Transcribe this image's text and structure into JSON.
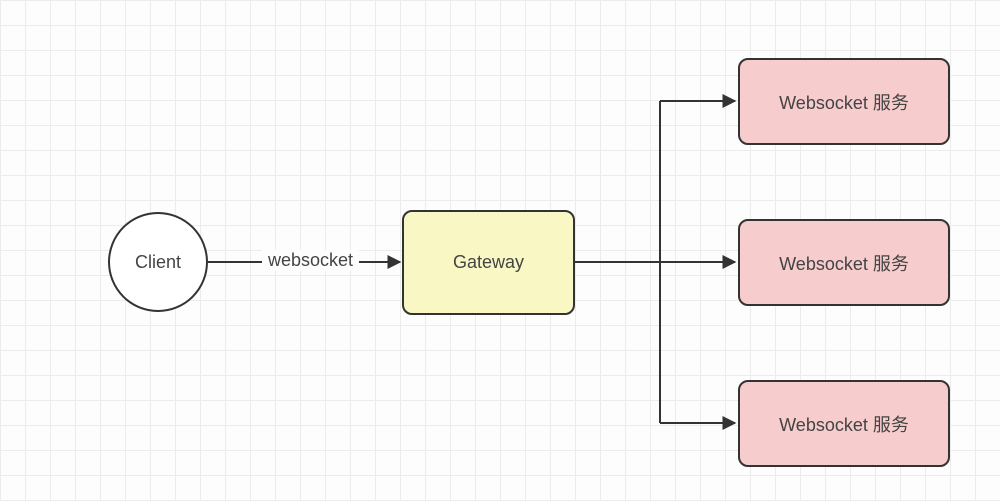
{
  "nodes": {
    "client": {
      "label": "Client"
    },
    "gateway": {
      "label": "Gateway"
    },
    "service1": {
      "label": "Websocket 服务"
    },
    "service2": {
      "label": "Websocket 服务"
    },
    "service3": {
      "label": "Websocket 服务"
    }
  },
  "edges": {
    "client_gateway": {
      "label": "websocket"
    }
  }
}
